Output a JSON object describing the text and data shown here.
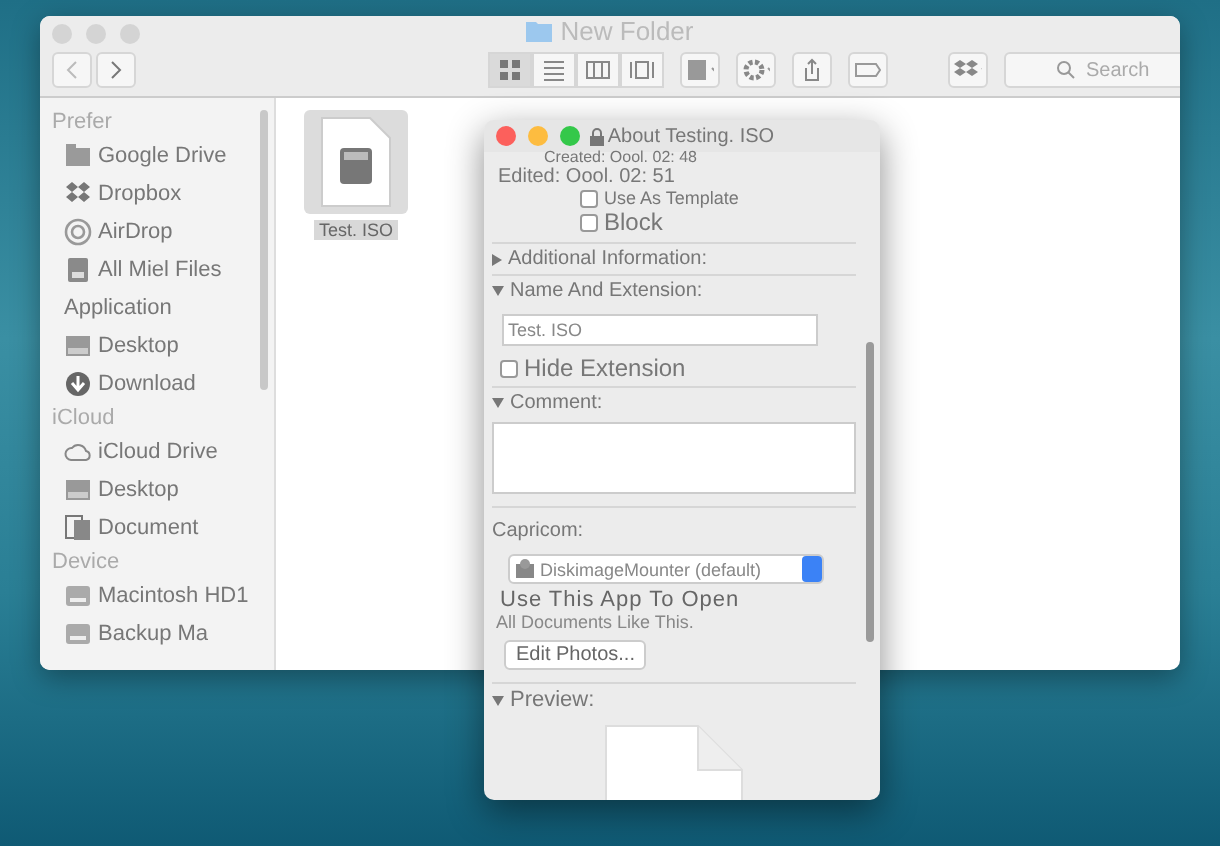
{
  "finder": {
    "title": "New Folder",
    "view_modes": [
      {
        "kind": "icons",
        "selected": true
      },
      {
        "kind": "list",
        "selected": false
      },
      {
        "kind": "columns",
        "selected": false
      },
      {
        "kind": "cover",
        "selected": false
      }
    ],
    "search": {
      "placeholder": "Search"
    },
    "sidebar": [
      {
        "header": "Prefer",
        "items": [
          {
            "kind": "folder",
            "label": "Google Drive"
          },
          {
            "kind": "dropbox",
            "label": "Dropbox"
          },
          {
            "kind": "airdrop",
            "label": "AirDrop"
          },
          {
            "kind": "files",
            "label": "All Miel Files"
          },
          {
            "kind": "none",
            "label": "Application"
          },
          {
            "kind": "desktop",
            "label": "Desktop"
          },
          {
            "kind": "download",
            "label": "Download"
          }
        ]
      },
      {
        "header": "iCloud",
        "items": [
          {
            "kind": "cloud",
            "label": "iCloud Drive"
          },
          {
            "kind": "desktop",
            "label": "Desktop"
          },
          {
            "kind": "document",
            "label": "Document"
          }
        ]
      },
      {
        "header": "Device",
        "items": [
          {
            "kind": "disk",
            "label": "Macintosh HD1"
          },
          {
            "kind": "disk",
            "label": "Backup Ma"
          }
        ]
      }
    ],
    "files": [
      {
        "name": "Test. ISO",
        "selected": true
      }
    ]
  },
  "info": {
    "title": "About Testing. ISO",
    "created": "Created: Oool. 02: 48",
    "edited": "Edited: Oool. 02: 51",
    "template": {
      "label": "Use As Template",
      "checked": false
    },
    "block": {
      "label": "Block",
      "checked": false
    },
    "sections": [
      {
        "label": "Additional Information:",
        "expanded": false
      },
      {
        "label": "Name And Extension:",
        "expanded": true
      },
      {
        "label": "Comment:",
        "expanded": true
      },
      {
        "label": "Preview:",
        "expanded": true
      }
    ],
    "name_value": "Test. ISO",
    "hide_extension": {
      "label": "Hide Extension",
      "checked": false
    },
    "open_with_label": "Capricom:",
    "app": "DiskimageMounter (default)",
    "use_app": "Use This App To Open",
    "all_docs": "All Documents Like This.",
    "change_button": "Edit Photos..."
  }
}
